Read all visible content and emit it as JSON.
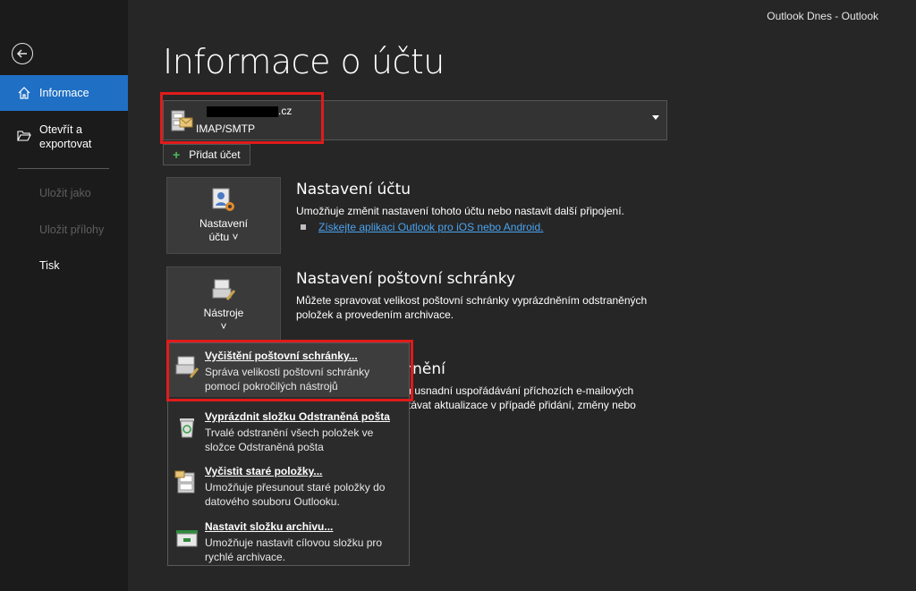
{
  "window": {
    "title": "Outlook Dnes  -  Outlook"
  },
  "sidebar": {
    "back_icon": "back-arrow-icon",
    "items": [
      {
        "label": "Informace",
        "icon": "home-icon",
        "active": true
      },
      {
        "label": "Otevřít a\nexportovat",
        "icon": "folder-open-icon"
      },
      {
        "label": "Uložit jako",
        "disabled": true
      },
      {
        "label": "Uložit přílohy",
        "disabled": true
      },
      {
        "label": "Tisk"
      }
    ]
  },
  "page": {
    "title": "Informace o účtu"
  },
  "account": {
    "email_suffix": ".cz",
    "type": "IMAP/SMTP",
    "add_button": "Přidat účet"
  },
  "sections": {
    "account_settings": {
      "tile_label_1": "Nastavení",
      "tile_label_2": "účtu ˅",
      "title": "Nastavení účtu",
      "desc": "Umožňuje změnit nastavení tohoto účtu nebo nastavit další připojení.",
      "link": "Získejte aplikaci Outlook pro iOS nebo Android."
    },
    "mailbox_settings": {
      "tile_label_1": "Nástroje",
      "tile_label_2": "˅",
      "title": "Nastavení poštovní schránky",
      "desc": "Můžete spravovat velikost poštovní schránky vyprázdněním odstraněných položek a provedením archivace."
    },
    "rules": {
      "title": "ornění",
      "desc": "m usnadní uspořádávání příchozích e-mailových\nstávat aktualizace v případě přidání, změny nebo"
    }
  },
  "menu": {
    "items": [
      {
        "title": "Vyčištění poštovní schránky...",
        "desc": "Správa velikosti poštovní schránky pomocí pokročilých nástrojů",
        "icon": "mailbox-cleanup-icon"
      },
      {
        "title": "Vyprázdnit složku Odstraněná pošta",
        "desc": "Trvalé odstranění všech položek ve složce Odstraněná pošta",
        "icon": "recycle-bin-icon"
      },
      {
        "title": "Vyčistit staré položky...",
        "desc": "Umožňuje přesunout staré položky do datového souboru Outlooku.",
        "icon": "archive-cabinet-icon"
      },
      {
        "title": "Nastavit složku archivu...",
        "desc": "Umožňuje nastavit cílovou složku pro rychlé archivace.",
        "icon": "archive-folder-icon"
      }
    ]
  },
  "colors": {
    "accent": "#1f6fc4",
    "highlight": "#e01b1b",
    "link": "#4aa3f0"
  }
}
